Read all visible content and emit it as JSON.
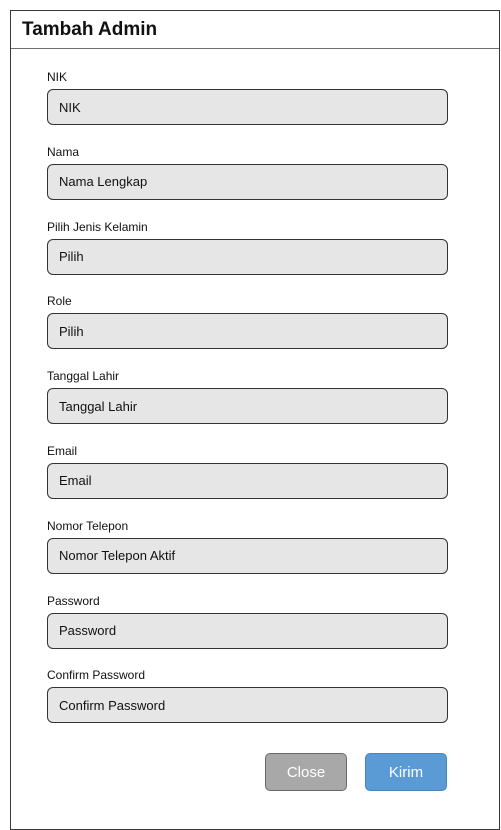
{
  "modal": {
    "title": "Tambah Admin"
  },
  "fields": [
    {
      "label": "NIK",
      "placeholder": "NIK"
    },
    {
      "label": "Nama",
      "placeholder": "Nama Lengkap"
    },
    {
      "label": "Pilih Jenis Kelamin",
      "placeholder": "Pilih"
    },
    {
      "label": "Role",
      "placeholder": "Pilih"
    },
    {
      "label": "Tanggal Lahir",
      "placeholder": "Tanggal Lahir"
    },
    {
      "label": "Email",
      "placeholder": "Email"
    },
    {
      "label": "Nomor Telepon",
      "placeholder": "Nomor Telepon Aktif"
    },
    {
      "label": "Password",
      "placeholder": "Password"
    },
    {
      "label": "Confirm Password",
      "placeholder": "Confirm Password"
    }
  ],
  "actions": {
    "close_label": "Close",
    "submit_label": "Kirim"
  },
  "colors": {
    "input_background": "#e6e6e6",
    "close_button": "#a8a8a8",
    "submit_button": "#5b9bd5"
  }
}
